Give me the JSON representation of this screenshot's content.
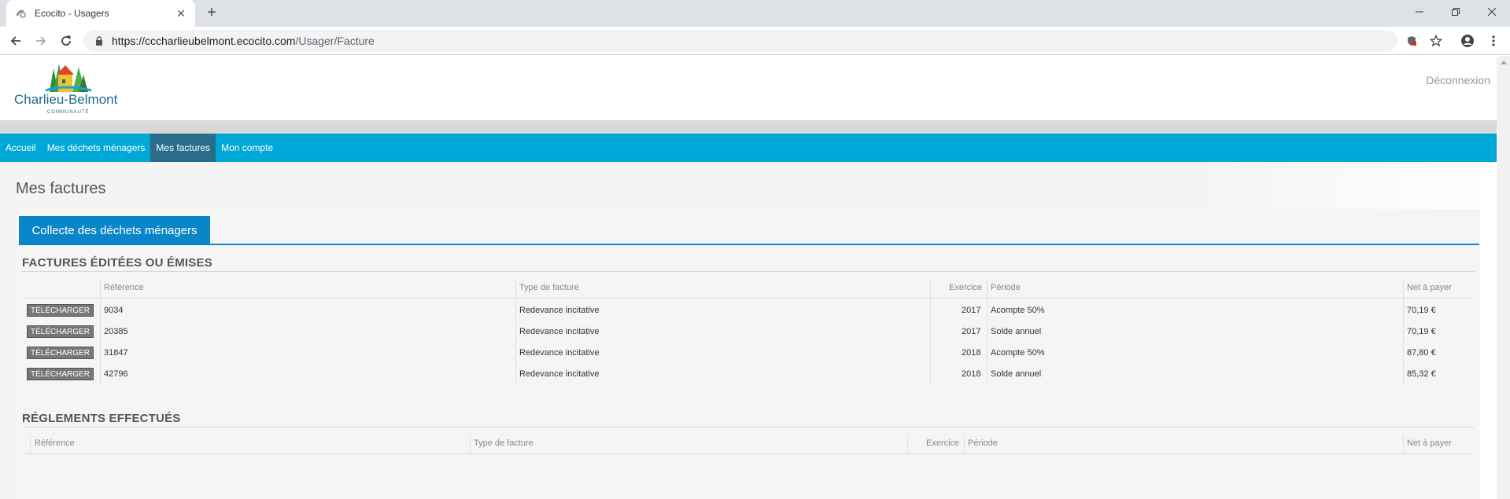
{
  "browser": {
    "tab_title": "Ecocito - Usagers",
    "tab_close": "✕",
    "new_tab": "+",
    "url_host": "https://cccharlieubelmont.ecocito.com",
    "url_path": "/Usager/Facture"
  },
  "header": {
    "logo_name": "Charlieu-Belmont",
    "logo_sub": "COMMUNAUTÉ",
    "logout": "Déconnexion"
  },
  "nav": {
    "items": [
      "Accueil",
      "Mes déchets ménagers",
      "Mes factures",
      "Mon compte"
    ],
    "active": "Mes factures"
  },
  "page": {
    "title": "Mes factures",
    "tab": "Collecte des déchets ménagers"
  },
  "invoices": {
    "title": "FACTURES ÉDITÉES OU ÉMISES",
    "headers": {
      "reference": "Référence",
      "type": "Type de facture",
      "exercice": "Exercice",
      "periode": "Période",
      "net": "Net à payer"
    },
    "button_label": "TÉLÉCHARGER",
    "rows": [
      {
        "reference": "9034",
        "type": "Redevance incitative",
        "exercice": "2017",
        "periode": "Acompte 50%",
        "net": "70,19 €"
      },
      {
        "reference": "20385",
        "type": "Redevance incitative",
        "exercice": "2017",
        "periode": "Solde annuel",
        "net": "70,19 €"
      },
      {
        "reference": "31847",
        "type": "Redevance incitative",
        "exercice": "2018",
        "periode": "Acompte 50%",
        "net": "87,80 €"
      },
      {
        "reference": "42796",
        "type": "Redevance incitative",
        "exercice": "2018",
        "periode": "Solde annuel",
        "net": "85,32 €"
      }
    ]
  },
  "payments": {
    "title": "RÉGLEMENTS EFFECTUÉS",
    "headers": {
      "reference": "Référence",
      "type": "Type de facture",
      "exercice": "Exercice",
      "periode": "Période",
      "net": "Net à payer"
    }
  },
  "icons": [
    "favicon-icon",
    "back-arrow-icon",
    "forward-arrow-icon",
    "reload-icon",
    "lock-icon",
    "shield-icon",
    "star-icon",
    "account-icon",
    "menu-dots-icon",
    "minimize-icon",
    "maximize-icon",
    "close-icon"
  ],
  "colors": {
    "nav_bg": "#00a8d8",
    "nav_active": "#2b6c8a",
    "tab_bg": "#0a86c8",
    "button_bg": "#777777"
  }
}
